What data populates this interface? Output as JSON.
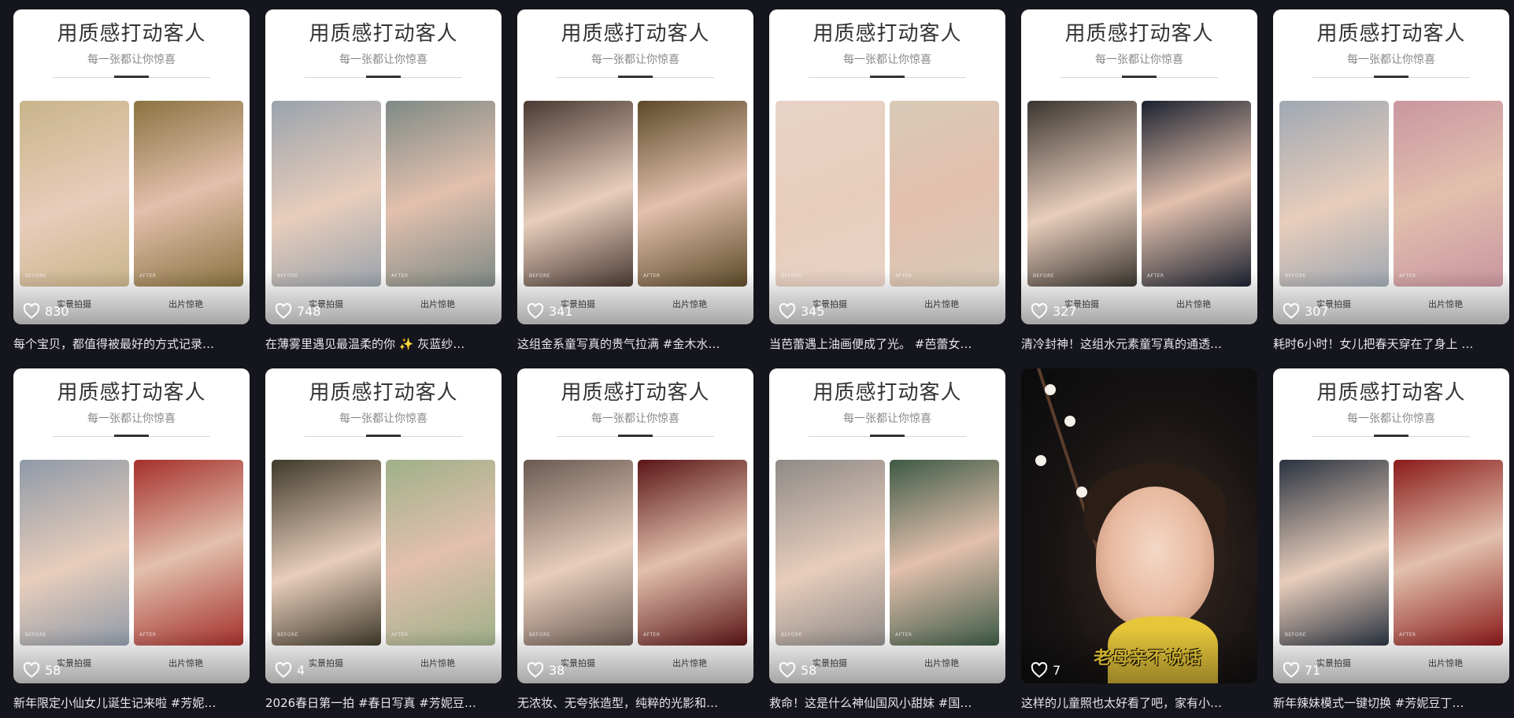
{
  "thumbnail_common": {
    "title": "用质感打动客人",
    "subtitle": "每一张都让你惊喜",
    "before_tag": "BEFORE",
    "after_tag": "AFTER",
    "left_label": "实景拍摄",
    "right_label": "出片惊艳"
  },
  "icons": {
    "like": "heart-icon"
  },
  "videos": [
    {
      "likes": "830",
      "caption": "每个宝贝，都值得被最好的方式记录…",
      "left_color": "#c9b48a",
      "right_color": "#8a7340"
    },
    {
      "likes": "748",
      "caption": "在薄雾里遇见最温柔的你 ✨ 灰蓝纱…",
      "left_color": "#9aa3ad",
      "right_color": "#7f8a86"
    },
    {
      "likes": "341",
      "caption": "这组金系童写真的贵气拉满 #金木水…",
      "left_color": "#4a3a33",
      "right_color": "#5c4a2a"
    },
    {
      "likes": "345",
      "caption": "当芭蕾遇上油画便成了光。 #芭蕾女…",
      "left_color": "#e8d3c6",
      "right_color": "#d9c9b7"
    },
    {
      "likes": "327",
      "caption": "清冷封神！这组水元素童写真的通透…",
      "left_color": "#3a3530",
      "right_color": "#1c2230"
    },
    {
      "likes": "307",
      "caption": "耗时6小时！女儿把春天穿在了身上 …",
      "left_color": "#9fa8b3",
      "right_color": "#c996a0"
    },
    {
      "likes": "58",
      "caption": "新年限定小仙女儿诞生记来啦 #芳妮…",
      "left_color": "#8f9aa8",
      "right_color": "#a5302d"
    },
    {
      "likes": "4",
      "caption": "2026春日第一拍 #春日写真 #芳妮豆…",
      "left_color": "#3f3a2a",
      "right_color": "#9fb08a"
    },
    {
      "likes": "38",
      "caption": "无浓妆、无夸张造型，纯粹的光影和…",
      "left_color": "#6a5a52",
      "right_color": "#5a1515"
    },
    {
      "likes": "58",
      "caption": "救命！这是什么神仙国风小甜妹 #国…",
      "left_color": "#8e8a88",
      "right_color": "#3d5a45"
    },
    {
      "likes": "7",
      "caption": "这样的儿童照也太好看了吧，家有小…",
      "full_image": true,
      "overlay_text": "老母亲不说话"
    },
    {
      "likes": "71",
      "caption": "新年辣妹模式一键切换 #芳妮豆丁…",
      "left_color": "#2a3340",
      "right_color": "#8a1a1a"
    }
  ]
}
